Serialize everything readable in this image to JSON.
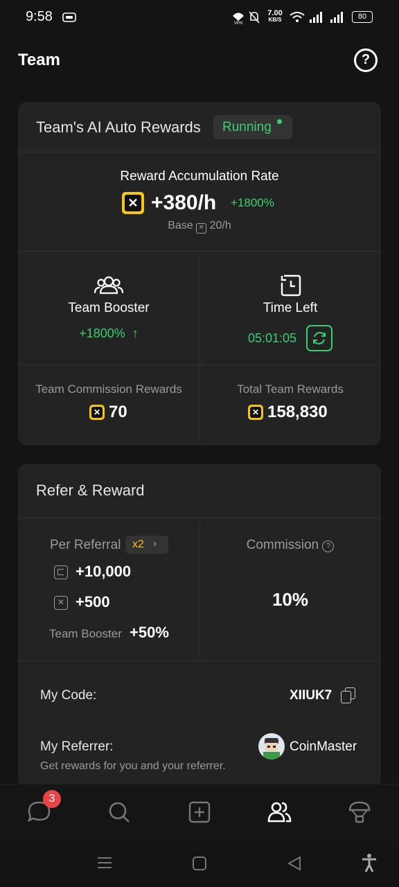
{
  "status_bar": {
    "time": "9:58",
    "speed_value": "7.00",
    "speed_unit": "KB/S",
    "vpn": "VPN",
    "battery": "80"
  },
  "header": {
    "title": "Team",
    "help_icon": "help-circle-icon"
  },
  "ai_rewards": {
    "title": "Team's AI Auto Rewards",
    "status": "Running",
    "rate_label": "Reward Accumulation Rate",
    "rate_value": "+380/h",
    "rate_bonus": "+1800%",
    "base_prefix": "Base",
    "base_value": "20/h",
    "team_booster_label": "Team Booster",
    "team_booster_value": "+1800%",
    "time_left_label": "Time Left",
    "time_left_value": "05:01:05",
    "commission_label": "Team Commission Rewards",
    "commission_value": "70",
    "total_label": "Total Team Rewards",
    "total_value": "158,830"
  },
  "refer": {
    "title": "Refer & Reward",
    "per_referral_label": "Per Referral",
    "multiplier": "x2",
    "coin_reward": "+10,000",
    "token_reward": "+500",
    "team_booster_label": "Team Booster",
    "team_booster_value": "+50%",
    "commission_label": "Commission",
    "commission_value": "10%",
    "my_code_label": "My Code:",
    "my_code_value": "XIIUK7",
    "my_referrer_label": "My Referrer:",
    "referrer_name": "CoinMaster",
    "referrer_note": "Get rewards for you and your referrer."
  },
  "bottom_nav": {
    "chat_badge": "3",
    "items": [
      "chat-icon",
      "search-icon",
      "add-icon",
      "team-icon",
      "airdrop-icon"
    ]
  },
  "colors": {
    "accent_green": "#3ad070",
    "token_yellow": "#f5c518",
    "card_bg": "#232323",
    "page_bg": "#141414"
  }
}
